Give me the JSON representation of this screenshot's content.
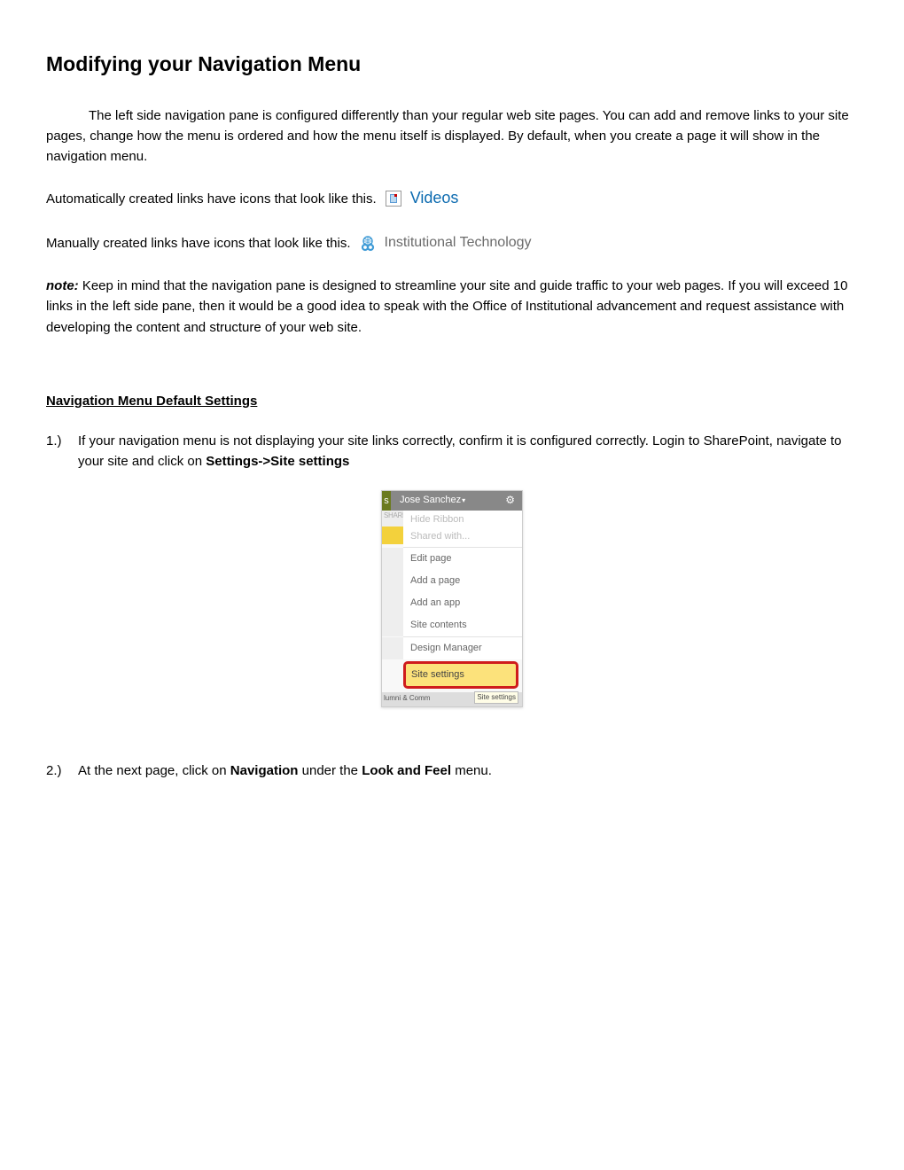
{
  "title": "Modifying your Navigation Menu",
  "intro": "The left side navigation pane is configured differently than your regular web site pages.  You can add and remove links to your site pages, change how the menu is ordered and how the menu itself is displayed.  By default, when you create a page it will show in the navigation menu.",
  "auto_link_text": "Automatically created links have icons that look like this.  ",
  "auto_link_example": "Videos",
  "manual_link_text": "Manually created links have icons that look like this.  ",
  "manual_link_example": "Institutional Technology",
  "note_label": "note:",
  "note_body": " Keep in mind that the navigation pane is designed to streamline your site and guide traffic to your web pages.  If you will exceed 10 links in the left side pane, then it would be a good idea to speak with the Office of Institutional advancement and request assistance with developing the content and structure of your web site.",
  "section_heading": "Navigation Menu Default Settings",
  "step1_num": "1.)",
  "step1_a": "If your navigation menu is not displaying your site links correctly, confirm it is configured correctly.  Login to SharePoint, navigate to your site and click on ",
  "step1_b": "Settings->Site settings",
  "screenshot": {
    "user": "Jose Sanchez",
    "share_label": "SHARE",
    "items": {
      "hide_ribbon": "Hide Ribbon",
      "shared_with": "Shared with...",
      "edit_page": "Edit page",
      "add_page": "Add a page",
      "add_app": "Add an app",
      "site_contents": "Site contents",
      "design_manager": "Design Manager",
      "site_settings": "Site settings"
    },
    "bottom_text": "lumni & Comm",
    "tooltip": "Site settings"
  },
  "step2_num": "2.)",
  "step2_a": "At the next page, click on ",
  "step2_b": "Navigation",
  "step2_c": " under the ",
  "step2_d": "Look and Feel",
  "step2_e": " menu."
}
